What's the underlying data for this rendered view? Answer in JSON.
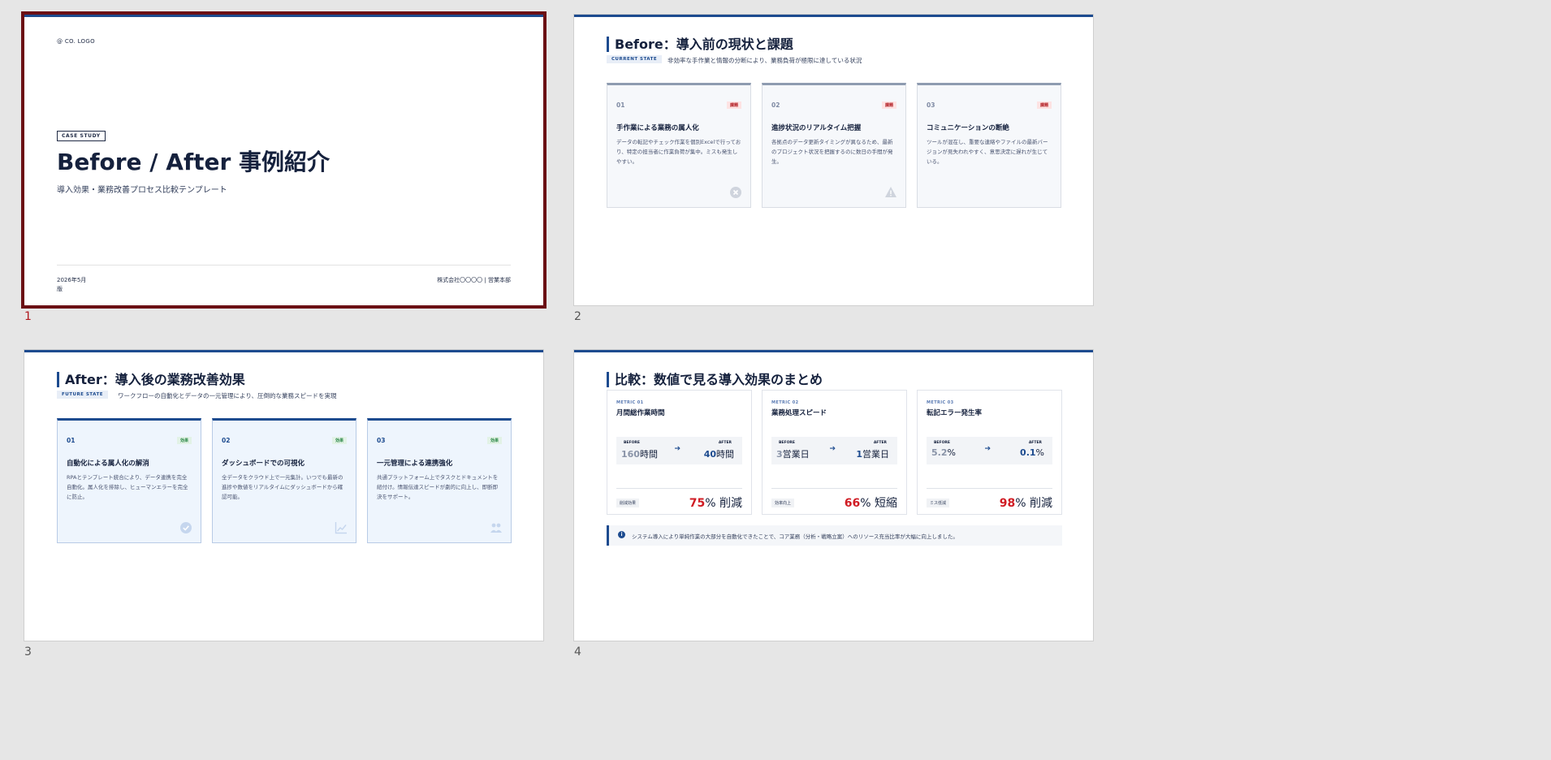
{
  "slides": [
    {
      "number": "1",
      "logo": "@ CO. LOGO",
      "badge": "CASE STUDY",
      "title": "Before / After 事例紹介",
      "subtitle": "導入効果・業務改善プロセス比較テンプレート",
      "date": "2026年5月版",
      "company": "株式会社〇〇〇〇 | 営業本部"
    },
    {
      "number": "2",
      "title": "Before：導入前の現状と課題",
      "badge": "CURRENT STATE",
      "desc": "非効率な手作業と情報の分断により、業務負荷が極限に達している状況",
      "cards": [
        {
          "num": "01",
          "tag": "課題",
          "title": "手作業による業務の属人化",
          "body": "データの転記やチェック作業を個別Excelで行っており、特定の担当者に作業負荷が集中。ミスも発生しやすい。",
          "icon": "x-circle-icon"
        },
        {
          "num": "02",
          "tag": "課題",
          "title": "進捗状況のリアルタイム把握",
          "body": "各拠点のデータ更新タイミングが異なるため、最新のプロジェクト状況を把握するのに数日の手間が発生。",
          "icon": "warning-icon"
        },
        {
          "num": "03",
          "tag": "課題",
          "title": "コミュニケーションの断絶",
          "body": "ツールが混在し、重要な連絡やファイルの最新バージョンが見失われやすく、意思決定に遅れが生じている。",
          "icon": ""
        }
      ]
    },
    {
      "number": "3",
      "title": "After：導入後の業務改善効果",
      "badge": "FUTURE STATE",
      "desc": "ワークフローの自動化とデータの一元管理により、圧倒的な業務スピードを実現",
      "cards": [
        {
          "num": "01",
          "tag": "効果",
          "title": "自動化による属人化の解消",
          "body": "RPAとテンプレート統合により、データ連携を完全自動化。属人化を排除し、ヒューマンエラーを完全に防止。",
          "icon": "check-circle-icon"
        },
        {
          "num": "02",
          "tag": "効果",
          "title": "ダッシュボードでの可視化",
          "body": "全データをクラウド上で一元集計。いつでも最新の進捗や数値をリアルタイムにダッシュボードから確認可能。",
          "icon": "chart-icon"
        },
        {
          "num": "03",
          "tag": "効果",
          "title": "一元管理による連携強化",
          "body": "共通プラットフォーム上でタスクとドキュメントを紐付け。情報伝達スピードが劇的に向上し、即断即決をサポート。",
          "icon": "team-icon"
        }
      ]
    },
    {
      "number": "4",
      "title": "比較：数値で見る導入効果のまとめ",
      "metrics": [
        {
          "label": "METRIC 01",
          "title": "月間総作業時間",
          "before_label": "BEFORE",
          "after_label": "AFTER",
          "before_value": "160",
          "before_unit": "時間",
          "after_value": "40",
          "after_unit": "時間",
          "tag": "削減効果",
          "result_value": "75",
          "result_unit": "% 削減"
        },
        {
          "label": "METRIC 02",
          "title": "業務処理スピード",
          "before_label": "BEFORE",
          "after_label": "AFTER",
          "before_value": "3",
          "before_unit": "営業日",
          "after_value": "1",
          "after_unit": "営業日",
          "tag": "効率向上",
          "result_value": "66",
          "result_unit": "% 短縮"
        },
        {
          "label": "METRIC 03",
          "title": "転記エラー発生率",
          "before_label": "BEFORE",
          "after_label": "AFTER",
          "before_value": "5.2",
          "before_unit": "%",
          "after_value": "0.1",
          "after_unit": "%",
          "tag": "ミス低減",
          "result_value": "98",
          "result_unit": "% 削減"
        }
      ],
      "note": "システム導入により単純作業の大部分を自動化できたことで、コア業務（分析・戦略立案）へのリソース充当比率が大幅に向上しました。"
    }
  ],
  "colors": {
    "accent": "#1d4b8f",
    "selected": "#6b0f14",
    "result": "#d01c24"
  }
}
